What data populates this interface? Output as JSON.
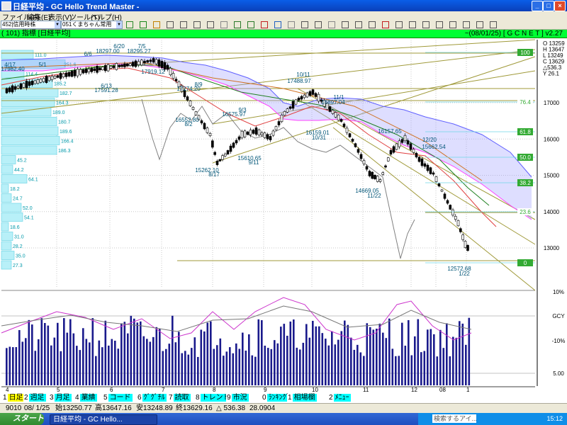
{
  "window": {
    "title": "日経平均 - GC Hello Trend Master - ",
    "min": "_",
    "max": "□",
    "close": "×"
  },
  "menu": [
    "ファイル(F)",
    "編集(E)",
    "表示(V)",
    "ツール(T)",
    "ヘルプ(H)"
  ],
  "toolbar": {
    "combo1": "452|信用時株",
    "combo2": "051くまちゃん常用"
  },
  "header": {
    "left": "( 101) 指標 [日経平均]",
    "right": "~(08/01/25) [ G C N E T ] v2.27"
  },
  "ohlc": [
    "O 13259",
    "H 13647",
    "L 13249",
    "C 13629",
    "△536.3",
    "Y 26.1"
  ],
  "price_labels": [
    "17000",
    "16000",
    "15000",
    "14000",
    "13000"
  ],
  "bottom_axis": [
    "10%",
    "GCY",
    "-10%",
    "5.00"
  ],
  "fib_labels": [
    "100",
    "76.4",
    "61.8",
    "50.0",
    "38.2",
    "23.6",
    "0"
  ],
  "month_labels": [
    "4",
    "5",
    "6",
    "7",
    "8",
    "9",
    "10",
    "11",
    "12",
    "08",
    "1"
  ],
  "annotations": [
    "6/20",
    "18297.00",
    "7/5",
    "18295.27",
    "6/6",
    "4/17",
    "17982.40",
    "5/1",
    "17919.12",
    "6/13",
    "17591.28",
    "8/9",
    "17274.20",
    "10/11",
    "17488.97",
    "11/1",
    "16897.04",
    "16552.80",
    "8/2",
    "9/3",
    "16575.97",
    "15262.10",
    "8/17",
    "15610.65",
    "9/11",
    "16159.01",
    "10/31",
    "16157.65",
    "12/20",
    "15662.54",
    "14669.05",
    "11/22",
    "12572.68",
    "1/22"
  ],
  "volume_profile": [
    "111.0",
    "251.6",
    "114.4",
    "185.2",
    "182.7",
    "164.3",
    "189.0",
    "180.7",
    "189.6",
    "166.4",
    "186.3",
    "45.2",
    "44.2",
    "64.1",
    "18.2",
    "24.7",
    "52.0",
    "54.1",
    "18.6",
    "31.0",
    "28.2",
    "35.0",
    "27.3"
  ],
  "tabs": [
    {
      "n": "1",
      "label": "日足",
      "active": true
    },
    {
      "n": "2",
      "label": "週足"
    },
    {
      "n": "3",
      "label": "月足"
    },
    {
      "n": "4",
      "label": "業績"
    },
    {
      "n": "5",
      "label": "コード"
    },
    {
      "n": "6",
      "label": "ｸﾞｸﾞﾁﾙ"
    },
    {
      "n": "7",
      "label": "読取"
    },
    {
      "n": "8",
      "label": "トレンド"
    },
    {
      "n": "9",
      "label": "市況"
    },
    {
      "n": "0",
      "label": "ﾗﾝｷﾝｸﾞ"
    },
    {
      "n": "1",
      "label": "相場欄"
    },
    {
      "n": "2",
      "label": "ﾒﾆｭｰ"
    }
  ],
  "status": {
    "code": "9010",
    "date": "08/ 1/25",
    "open": "始13250.77",
    "high": "高13647.16",
    "low": "安13248.89",
    "close": "終13629.16",
    "change": "△ 536.38",
    "ratio": "28.0904"
  },
  "taskbar": {
    "start": "スタート",
    "task": "日経平均 - GC Hello...",
    "search": "検索するアイ...",
    "clock": "15:12"
  },
  "colors": {
    "header_bg": "#00ff33",
    "candle_up": "#ffffff",
    "candle_down": "#000000",
    "cloud": "#7070ff",
    "volume_bar": "#1a1a8c"
  }
}
